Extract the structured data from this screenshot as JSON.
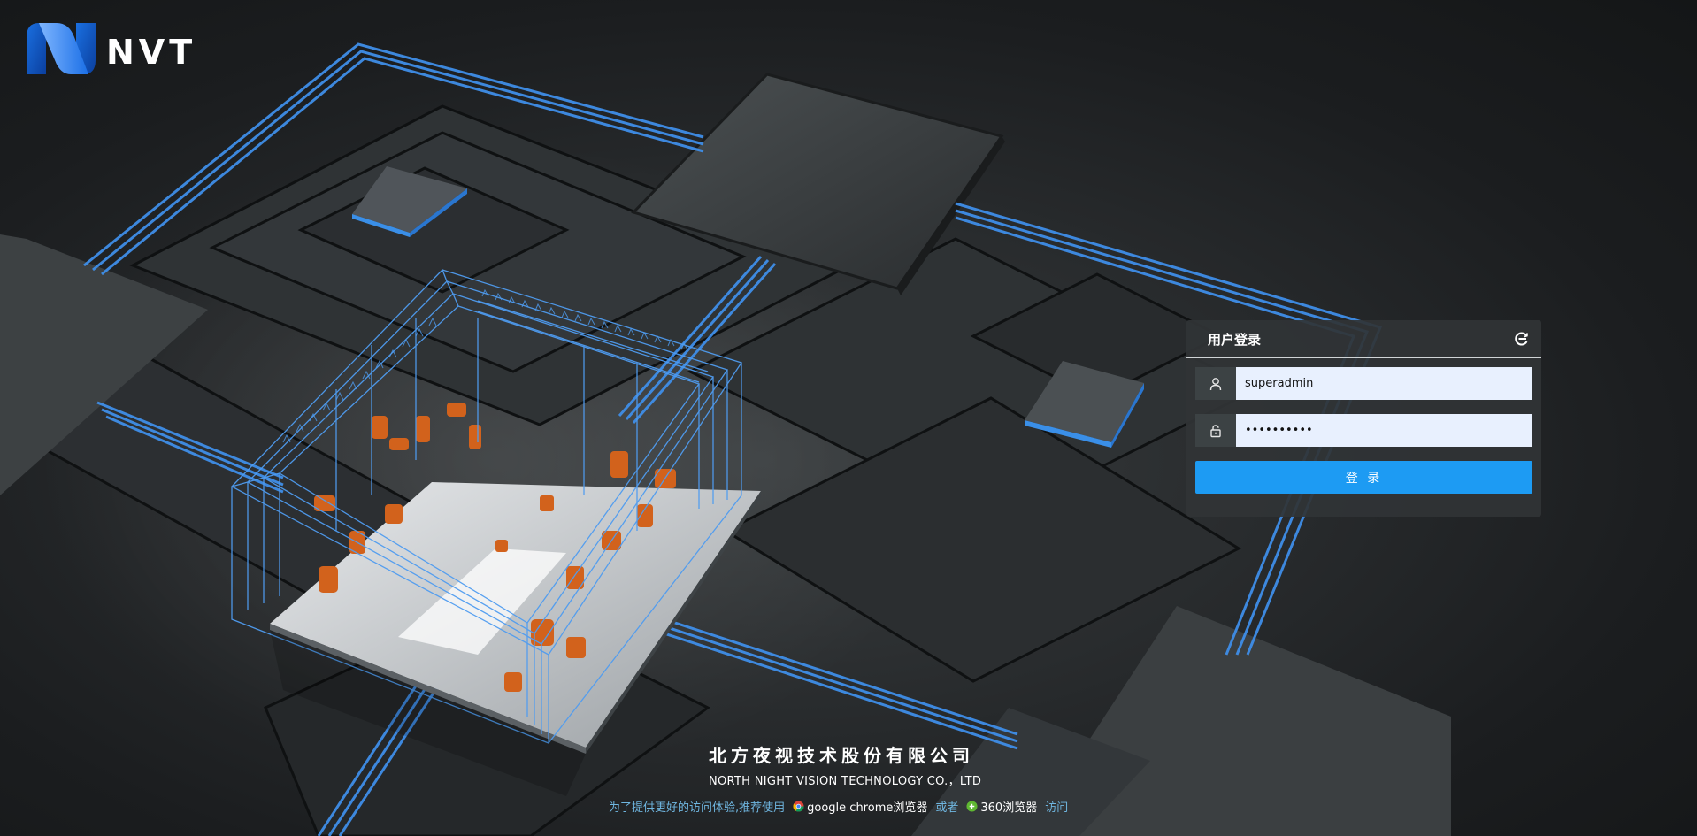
{
  "brand": {
    "logo_text": "NVT"
  },
  "login": {
    "title": "用户登录",
    "username_value": "superadmin",
    "password_value": "••••••••••",
    "submit_label": "登 录"
  },
  "footer": {
    "company_cn": "北方夜视技术股份有限公司",
    "company_en": "NORTH NIGHT VISION TECHNOLOGY CO.，LTD",
    "hint_prefix": "为了提供更好的访问体验,推荐使用",
    "browser_chrome": "google chrome浏览器",
    "or_text": "或者",
    "browser_360": "360浏览器",
    "visit_text": "访问"
  },
  "colors": {
    "accent": "#1d9bf3",
    "circuit_line": "#3f8ee8",
    "robot": "#d2621c",
    "hint": "#6fb6e0"
  },
  "icons": {
    "refresh": "refresh-icon",
    "user": "user-icon",
    "lock": "lock-icon",
    "chrome": "chrome-icon",
    "browser360": "browser-360-icon"
  }
}
